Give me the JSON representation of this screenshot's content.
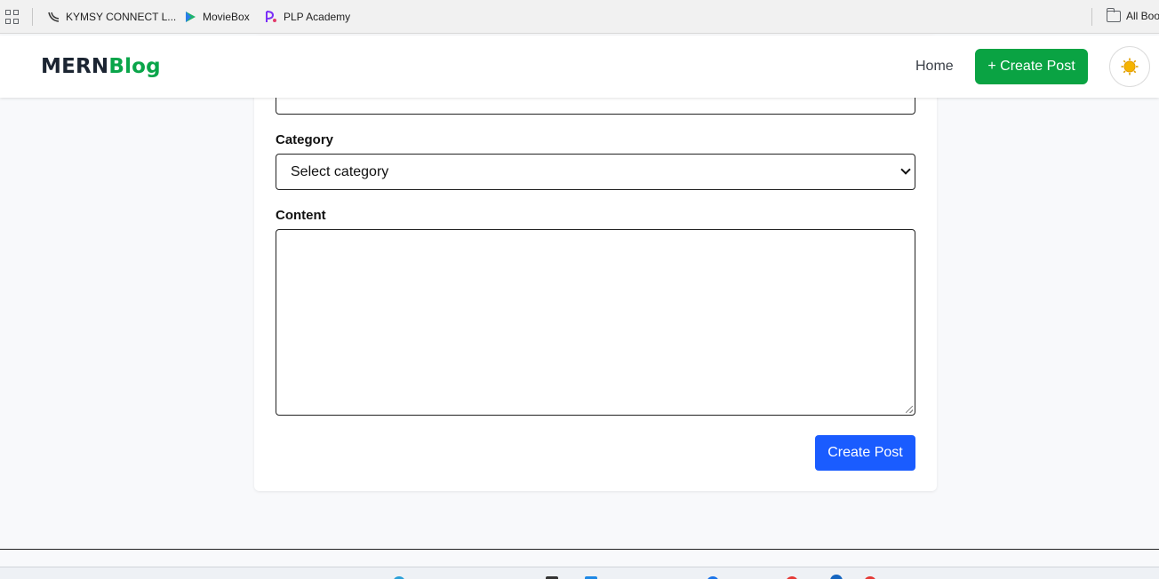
{
  "bookmarks": {
    "items": [
      {
        "label": "KYMSY CONNECT L...",
        "icon": "kymsy-icon"
      },
      {
        "label": "MovieBox",
        "icon": "moviebox-play-icon"
      },
      {
        "label": "PLP Academy",
        "icon": "plp-academy-icon"
      }
    ],
    "all_bookmarks_label": "All Boo"
  },
  "navbar": {
    "brand_mern": "MERN",
    "brand_blog": "Blog",
    "home_label": "Home",
    "create_post_label": "+ Create Post",
    "theme_icon": "sun-icon"
  },
  "form": {
    "category_label": "Category",
    "category_selected": "Select category",
    "content_label": "Content",
    "submit_label": "Create Post"
  },
  "colors": {
    "brand_dark": "#1c2532",
    "brand_green": "#0aa54a",
    "create_button_green": "#0aa343",
    "submit_blue": "#1a5cff",
    "page_bg": "#f8f9fb"
  }
}
